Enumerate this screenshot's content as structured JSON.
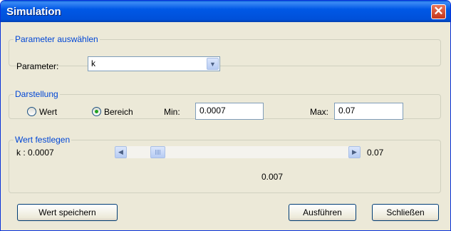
{
  "window": {
    "title": "Simulation",
    "close_glyph": "✕"
  },
  "parameter_group": {
    "legend": "Parameter auswählen",
    "label": "Parameter:",
    "selected": "k",
    "dropdown_icon": "chevron-down-icon"
  },
  "darstellung_group": {
    "legend": "Darstellung",
    "radio_wert": "Wert",
    "radio_bereich": "Bereich",
    "selected_mode": "Bereich",
    "min_label": "Min:",
    "min_value": "0.0007",
    "max_label": "Max:",
    "max_value": "0.07"
  },
  "wert_group": {
    "legend": "Wert festlegen",
    "current_label": "k : 0.0007",
    "max_label": "0.07",
    "value_display": "0.007",
    "slider_position": 0.02
  },
  "buttons": {
    "save": "Wert speichern",
    "run": "Ausführen",
    "close": "Schließen"
  }
}
